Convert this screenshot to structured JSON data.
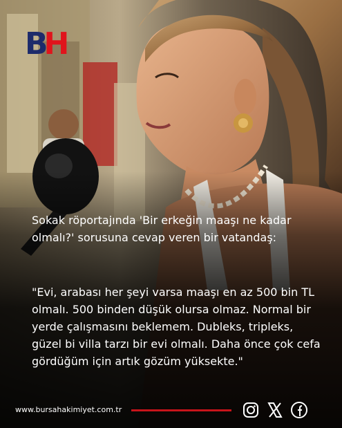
{
  "brand": {
    "logo_b": "B",
    "logo_h": "H"
  },
  "headline": "Sokak röportajında 'Bir erkeğin maaşı ne kadar olmalı?' sorusuna cevap veren bir vatandaş:",
  "quote": "\"Evi, arabası her şeyi varsa maaşı en az 500 bin TL olmalı. 500 binden düşük olursa olmaz. Normal bir yerde çalışmasını beklemem. Dubleks, tripleks, güzel bi villa tarzı bir evi olmalı. Daha önce çok cefa gördüğüm için artık gözüm yüksekte.\"",
  "footer": {
    "website": "www.bursahakimiyet.com.tr",
    "social_icons": [
      "instagram-icon",
      "x-icon",
      "facebook-icon"
    ]
  },
  "colors": {
    "brand_red": "#e0141c",
    "brand_navy": "#1d2b6b",
    "text": "#ffffff",
    "accent_line": "#c8141a"
  }
}
